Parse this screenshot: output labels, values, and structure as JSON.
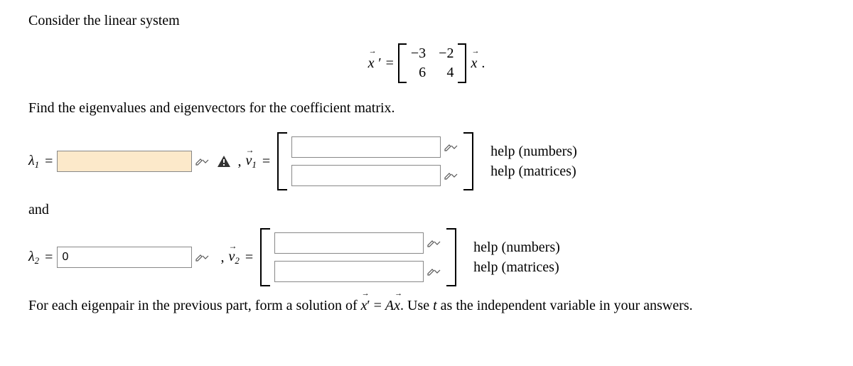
{
  "intro": "Consider the linear system",
  "equation": {
    "lhs_vec": "x",
    "equals": "=",
    "matrix": {
      "a11": "−",
      "v11": "3",
      "a12": "−",
      "v12": "2",
      "v21": "6",
      "v22": "4"
    },
    "rhs_vec": "x",
    "period": "."
  },
  "instruction": "Find the eigenvalues and eigenvectors for the coefficient matrix.",
  "row1": {
    "lambda": "λ",
    "sub": "1",
    "value": "",
    "vec_label": "v",
    "vec_sub": "1",
    "top_val": "",
    "bot_val": ""
  },
  "and": "and",
  "row2": {
    "lambda": "λ",
    "sub": "2",
    "value": "0",
    "vec_label": "v",
    "vec_sub": "2",
    "top_val": "",
    "bot_val": ""
  },
  "help": {
    "numbers": "help (numbers)",
    "matrices": "help (matrices)"
  },
  "final": {
    "prefix": "For each eigenpair in the previous part, form a solution of ",
    "vec1": "x",
    "eq": " = ",
    "A": "A",
    "vec2": "x",
    "suffix": ". Use ",
    "tvar": "t",
    "suffix2": " as the independent variable in your answers."
  }
}
